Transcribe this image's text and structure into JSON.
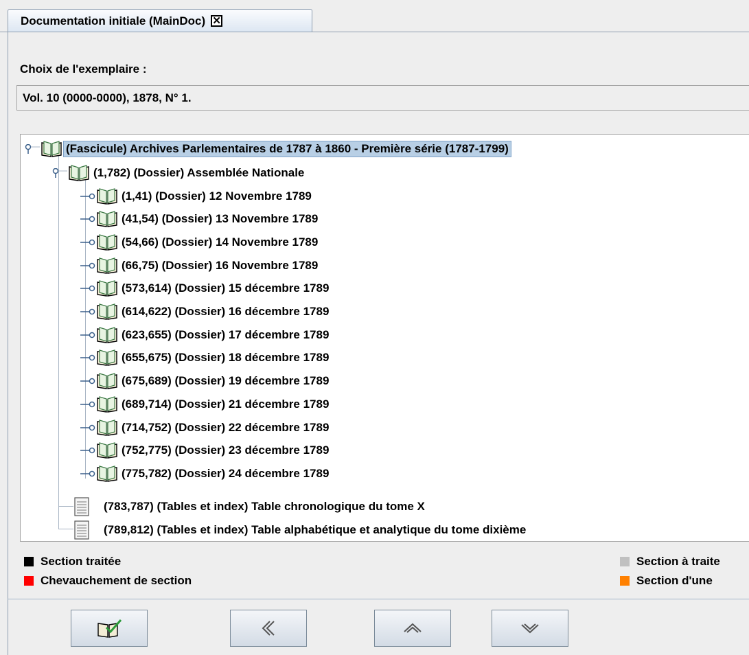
{
  "tab": {
    "title": "Documentation initiale (MainDoc)",
    "close_glyph": "✕"
  },
  "choice": {
    "label": "Choix de l'exemplaire :",
    "value": "Vol. 10 (0000-0000), 1878, N° 1."
  },
  "tree": {
    "root": "(Fascicule) Archives Parlementaires de 1787 à 1860 - Première série (1787-1799)",
    "dossier": "(1,782) (Dossier) Assemblée Nationale",
    "items": [
      "(1,41) (Dossier) 12 Novembre 1789",
      "(41,54) (Dossier) 13 Novembre 1789",
      "(54,66) (Dossier) 14 Novembre 1789",
      "(66,75) (Dossier) 16 Novembre 1789",
      "(573,614) (Dossier) 15 décembre 1789",
      "(614,622) (Dossier) 16 décembre 1789",
      "(623,655) (Dossier) 17 décembre 1789",
      "(655,675) (Dossier) 18 décembre 1789",
      "(675,689) (Dossier) 19 décembre 1789",
      "(689,714) (Dossier) 21 décembre 1789",
      "(714,752) (Dossier) 22 décembre 1789",
      "(752,775) (Dossier) 23 décembre 1789",
      "(775,782) (Dossier) 24 décembre 1789"
    ],
    "tables": [
      "(783,787) (Tables et index) Table chronologique du tome X",
      "(789,812) (Tables et index) Table alphabétique et analytique du tome dixième"
    ]
  },
  "legend": {
    "processed": "Section traitée",
    "overlap": "Chevauchement de section",
    "to_process": "Section à traite",
    "other": "Section d'une",
    "colors": {
      "processed": "#000000",
      "overlap": "#ff0000",
      "to_process": "#c0c0c0",
      "other": "#ff8000"
    }
  },
  "buttons": {
    "validate": "book-check-icon",
    "back": "double-chevron-left-icon",
    "up": "chevron-up-icon",
    "down": "chevron-down-icon"
  }
}
